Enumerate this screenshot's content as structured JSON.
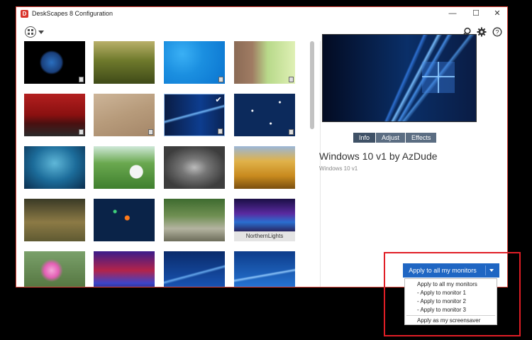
{
  "window": {
    "title": "DeskScapes 8 Configuration",
    "icon_letter": "D",
    "controls": {
      "minimize": "—",
      "maximize": "☐",
      "close": "✕"
    }
  },
  "toolbar": {
    "view_icon": "view-grid-icon",
    "search_icon": "search-icon",
    "settings_icon": "gear-icon",
    "help_icon": "help-icon",
    "help_glyph": "?"
  },
  "gallery": {
    "thumbnails": [
      {
        "name": "earth",
        "selected": false
      },
      {
        "name": "grass-field",
        "selected": false
      },
      {
        "name": "blue-ripple",
        "selected": false
      },
      {
        "name": "tree-bark",
        "selected": false
      },
      {
        "name": "red-car-street",
        "selected": false
      },
      {
        "name": "sand-ripples",
        "selected": false
      },
      {
        "name": "windows-10-v1",
        "selected": true
      },
      {
        "name": "blue-sparkles",
        "selected": false
      },
      {
        "name": "floating-tree",
        "selected": false
      },
      {
        "name": "golf-ball",
        "selected": false
      },
      {
        "name": "gray-creature",
        "selected": false
      },
      {
        "name": "wheat-field",
        "selected": false
      },
      {
        "name": "grass-light",
        "selected": false
      },
      {
        "name": "space-orbs",
        "selected": false
      },
      {
        "name": "tree-road",
        "selected": false
      },
      {
        "name": "northern-lights",
        "selected": false,
        "label": "NorthernLights"
      },
      {
        "name": "pink-flower",
        "selected": false
      },
      {
        "name": "red-blue-glow",
        "selected": false
      },
      {
        "name": "windows-blue-1",
        "selected": false
      },
      {
        "name": "windows-blue-2",
        "selected": false
      }
    ],
    "selected_check": "✔"
  },
  "detail": {
    "tabs": [
      "Info",
      "Adjust",
      "Effects"
    ],
    "active_tab": "Info",
    "title": "Windows 10 v1 by AzDude",
    "subtitle": "Windows 10 v1"
  },
  "apply": {
    "button_label": "Apply to all my monitors",
    "menu": [
      "Apply to all my monitors",
      "- Apply to monitor 1",
      "- Apply to monitor 2",
      "- Apply to monitor 3",
      "Apply as my screensaver"
    ]
  },
  "colors": {
    "accent_blue": "#1f66c3",
    "tab_bg": "#5b6d82",
    "highlight_red": "#e01e26",
    "window_border": "#e0463c"
  }
}
